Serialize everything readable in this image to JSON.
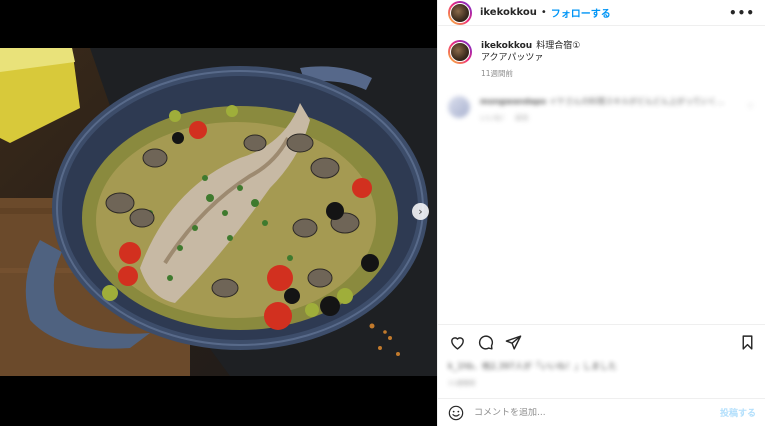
{
  "post": {
    "username": "ikekokkou",
    "separator": "•",
    "follow_label": "フォローする",
    "more_icon": "more-horizontal-icon",
    "caption_line1": "料理合宿①",
    "caption_line2": "アクアパッツァ",
    "caption_time": "11週間前"
  },
  "comment": {
    "username": "mongwandapo",
    "text": "イケさんの料理スキルがどんどん上がっていく…",
    "meta_likes": "いいね！",
    "meta_reply": "返信"
  },
  "actions": {
    "like_icon": "heart-icon",
    "comment_icon": "comment-icon",
    "share_icon": "share-icon",
    "save_icon": "bookmark-icon"
  },
  "likes": {
    "text": "k_1hb、他2,397人が「いいね！」しました",
    "date": "11週間前"
  },
  "comment_bar": {
    "placeholder": "コメントを追加...",
    "post_label": "投稿する"
  },
  "carousel": {
    "next_arrow": "›",
    "slide_count": 2,
    "active_slide": 1
  },
  "colors": {
    "accent": "#0095f6",
    "post_disabled": "#b2dffc",
    "text": "#262626",
    "secondary": "#8e8e8e"
  }
}
